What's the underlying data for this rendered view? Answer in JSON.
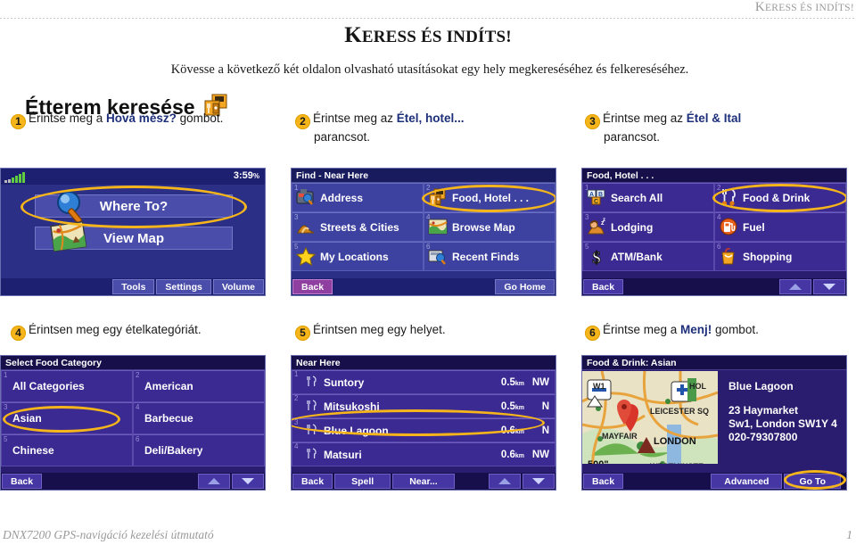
{
  "running_head": {
    "text_first": "K",
    "text_rest": "ERESS ÉS INDÍTS!"
  },
  "page_title": {
    "first": "K",
    "rest": "ERESS ÉS INDÍTS!"
  },
  "intro": "Kövesse a következő két oldalon olvasható utasításokat egy hely megkereséséhez és felkereséséhez.",
  "section_head": {
    "label": "Étterem keresése",
    "icon": "food-hotel-icon"
  },
  "colors": {
    "accent_highlight": "#f5b51b",
    "link_blue": "#1d2f7a",
    "screen_blue": "#2b2f86",
    "screen_purple": "#2a1c6e",
    "tile_blue": "#3d41a0",
    "tile_purple": "#3b2a91",
    "back_magenta": "#8e3fa0",
    "signal_green": "#5fcf3f"
  },
  "steps": [
    {
      "n": "1",
      "line1_pre": "Érintse meg a ",
      "bold": "Hová mész?",
      "line1_post": " gombot.",
      "line2": ""
    },
    {
      "n": "2",
      "line1_pre": "Érintse meg az ",
      "bold": "Étel, hotel...",
      "line1_post": "",
      "line2": "parancsot."
    },
    {
      "n": "3",
      "line1_pre": "Érintse meg az ",
      "bold": "Étel & Ital",
      "line1_post": "",
      "line2": "parancsot."
    },
    {
      "n": "4",
      "line1_pre": "Érintsen meg egy ételkategóriát.",
      "bold": "",
      "line1_post": "",
      "line2": ""
    },
    {
      "n": "5",
      "line1_pre": "Érintsen meg egy helyet.",
      "bold": "",
      "line1_post": "",
      "line2": ""
    },
    {
      "n": "6",
      "line1_pre": "Érintse meg a ",
      "bold": "Menj!",
      "line1_post": " gombot.",
      "line2": ""
    }
  ],
  "screen1": {
    "name": "home-screen",
    "clock": "3:59",
    "clock_unit": "%",
    "buttons": [
      {
        "label": "Where To?",
        "icon": "magnifier-icon",
        "highlighted": true
      },
      {
        "label": "View Map",
        "icon": "map-icon",
        "highlighted": false
      }
    ],
    "bottom": [
      {
        "label": "Tools",
        "name": "tools-button"
      },
      {
        "label": "Settings",
        "name": "settings-button"
      },
      {
        "label": "Volume",
        "name": "volume-button"
      }
    ]
  },
  "screen2": {
    "title": "Find - Near Here",
    "tiles": [
      {
        "num": "1",
        "label": "Address",
        "icon": "address-camera-icon",
        "highlighted": false
      },
      {
        "num": "2",
        "label": "Food, Hotel . . .",
        "icon": "food-hotel-icon",
        "highlighted": true
      },
      {
        "num": "3",
        "label": "Streets & Cities",
        "icon": "streets-cities-icon",
        "highlighted": false
      },
      {
        "num": "4",
        "label": "Browse Map",
        "icon": "browse-map-icon",
        "highlighted": false
      },
      {
        "num": "5",
        "label": "My Locations",
        "icon": "star-icon",
        "highlighted": false
      },
      {
        "num": "6",
        "label": "Recent Finds",
        "icon": "recent-finds-icon",
        "highlighted": false
      }
    ],
    "bottom_left": "Back",
    "bottom_right": "Go Home"
  },
  "screen3": {
    "title": "Food, Hotel . . .",
    "tiles": [
      {
        "num": "1",
        "label": "Search All",
        "icon": "abc-blocks-icon",
        "highlighted": false
      },
      {
        "num": "2",
        "label": "Food & Drink",
        "icon": "cutlery-icon",
        "highlighted": true
      },
      {
        "num": "3",
        "label": "Lodging",
        "icon": "lodging-sleep-icon",
        "highlighted": false
      },
      {
        "num": "4",
        "label": "Fuel",
        "icon": "fuel-pump-icon",
        "highlighted": false
      },
      {
        "num": "5",
        "label": "ATM/Bank",
        "icon": "dollar-icon",
        "highlighted": false
      },
      {
        "num": "6",
        "label": "Shopping",
        "icon": "shopping-bag-icon",
        "highlighted": false
      }
    ],
    "bottom_left": "Back",
    "scroll_up": "scroll-up-icon",
    "scroll_down": "scroll-down-icon"
  },
  "screen4": {
    "title": "Select Food Category",
    "tiles": [
      {
        "num": "1",
        "label": "All Categories",
        "highlighted": false
      },
      {
        "num": "2",
        "label": "American",
        "highlighted": false
      },
      {
        "num": "3",
        "label": "Asian",
        "highlighted": true
      },
      {
        "num": "4",
        "label": "Barbecue",
        "highlighted": false
      },
      {
        "num": "5",
        "label": "Chinese",
        "highlighted": false
      },
      {
        "num": "6",
        "label": "Deli/Bakery",
        "highlighted": false
      }
    ],
    "bottom_left": "Back",
    "scroll_up": "scroll-up-icon",
    "scroll_down": "scroll-down-icon"
  },
  "screen5": {
    "title": "Near Here",
    "unit": "km",
    "rows": [
      {
        "num": "1",
        "name": "Suntory",
        "dist": "0.5",
        "dir": "NW",
        "highlighted": false
      },
      {
        "num": "2",
        "name": "Mitsukoshi",
        "dist": "0.5",
        "dir": "N",
        "highlighted": false
      },
      {
        "num": "3",
        "name": "Blue Lagoon",
        "dist": "0.6",
        "dir": "N",
        "highlighted": true
      },
      {
        "num": "4",
        "name": "Matsuri",
        "dist": "0.6",
        "dir": "NW",
        "highlighted": false
      }
    ],
    "bottom": [
      {
        "label": "Back",
        "name": "back-button"
      },
      {
        "label": "Spell",
        "name": "spell-button"
      },
      {
        "label": "Near...",
        "name": "near-button"
      }
    ]
  },
  "screen6": {
    "title": "Food & Drink: Asian",
    "place_name": "Blue Lagoon",
    "address_line1": "23 Haymarket",
    "address_line2": "Sw1, London SW1Y 4",
    "phone": "020-79307800",
    "map_labels": [
      "W1",
      "HOL",
      "LEICESTER SQ",
      "MAYFAIR",
      "LONDON",
      "WESTMINSTE"
    ],
    "map_scale": "500\"",
    "bottom": [
      {
        "label": "Back",
        "name": "back-button",
        "highlighted": false
      },
      {
        "label": "Advanced",
        "name": "advanced-button",
        "highlighted": false
      },
      {
        "label": "Go To",
        "name": "go-to-button",
        "highlighted": true
      }
    ]
  },
  "footer": {
    "text": "DNX7200 GPS-navigáció kezelési útmutató",
    "page": "1"
  }
}
